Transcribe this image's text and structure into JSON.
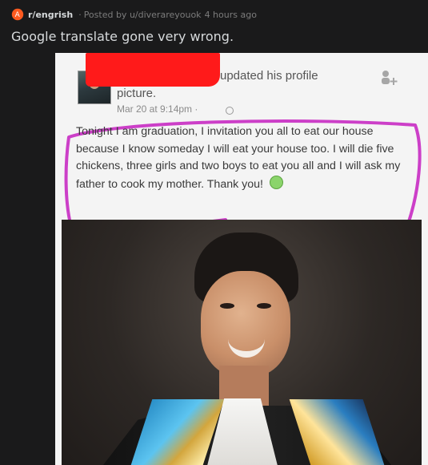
{
  "post": {
    "subreddit": "r/engrish",
    "posted_by": "Posted by u/diverareyouok",
    "time_ago": "4 hours ago",
    "title": "Google translate gone very wrong."
  },
  "facebook_post": {
    "header_line_1": "updated his profile",
    "header_line_2": "picture.",
    "timestamp": "Mar 20 at 9:14pm",
    "timestamp_separator": "·",
    "message": "Tonight I am graduation, I invitation you all to eat our house because I know someday I will eat your house too. I will die five chickens, three girls and two boys to eat you all and I will ask my father to cook my mother. Thank you!"
  },
  "icons": {
    "subreddit": "subreddit-icon",
    "add_friend": "add-friend-icon",
    "privacy": "globe-icon",
    "emoji": "heart-emoji-icon"
  },
  "colors": {
    "background": "#1a1a1b",
    "meta_text": "#7c7c7c",
    "title_text": "#d7dadc",
    "redaction": "#ff1a1a",
    "highlight": "#cc3fc8"
  }
}
